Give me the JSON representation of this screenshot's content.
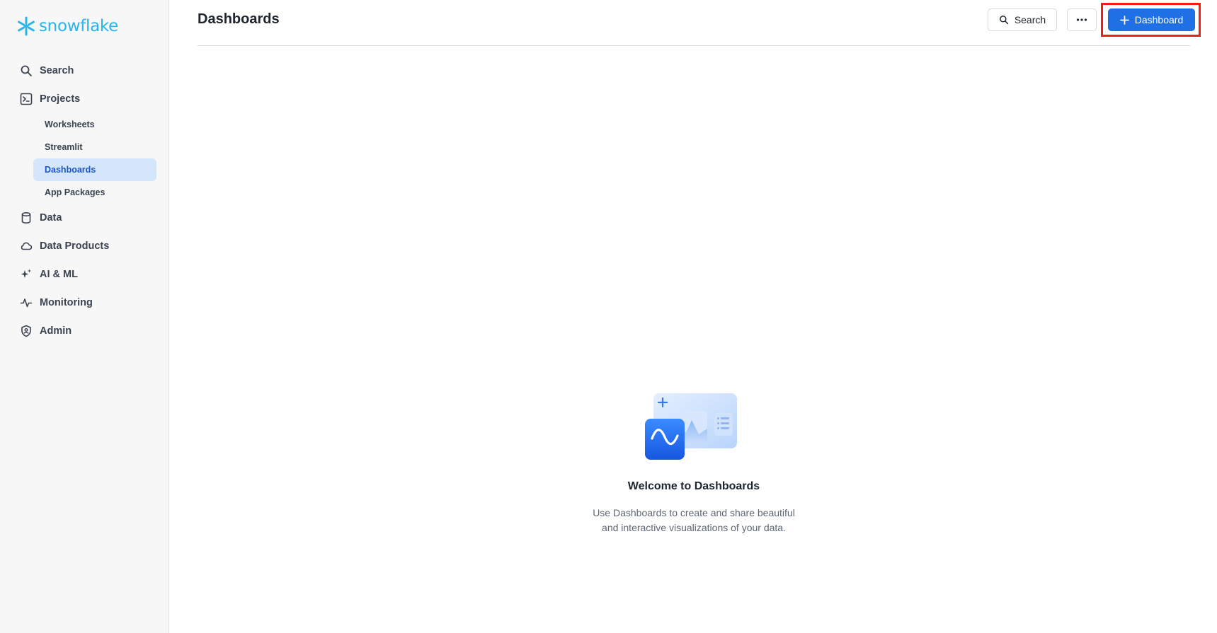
{
  "brand": {
    "name": "snowflake",
    "color": "#29b5e8"
  },
  "sidebar": {
    "items": [
      {
        "label": "Search",
        "icon": "search-icon"
      },
      {
        "label": "Projects",
        "icon": "terminal-icon"
      },
      {
        "label": "Data",
        "icon": "database-icon"
      },
      {
        "label": "Data Products",
        "icon": "cloud-icon"
      },
      {
        "label": "AI & ML",
        "icon": "sparkle-icon"
      },
      {
        "label": "Monitoring",
        "icon": "activity-icon"
      },
      {
        "label": "Admin",
        "icon": "shield-icon"
      }
    ],
    "projects_sub": [
      {
        "label": "Worksheets"
      },
      {
        "label": "Streamlit"
      },
      {
        "label": "Dashboards",
        "active": true
      },
      {
        "label": "App Packages"
      }
    ]
  },
  "header": {
    "title": "Dashboards",
    "search_label": "Search",
    "more_label": "···",
    "create_label": "Dashboard"
  },
  "empty_state": {
    "title": "Welcome to Dashboards",
    "description_line1": "Use Dashboards to create and share beautiful",
    "description_line2": "and interactive visualizations of your data."
  },
  "colors": {
    "primary": "#1f6fe5",
    "active_bg": "#d4e6fc",
    "highlight": "#f01e14"
  }
}
